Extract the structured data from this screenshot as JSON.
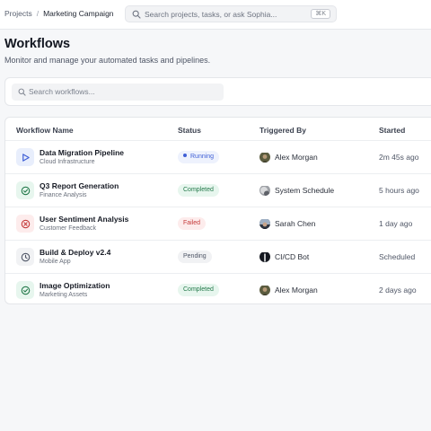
{
  "breadcrumb": {
    "parent": "Projects",
    "separator": "/",
    "current": "Marketing Campaign"
  },
  "global_search": {
    "placeholder": "Search projects, tasks, or ask Sophia...",
    "shortcut": "⌘K"
  },
  "page": {
    "title": "Workflows",
    "subtitle": "Monitor and manage your automated tasks and pipelines."
  },
  "filter": {
    "search_placeholder": "Search workflows..."
  },
  "table": {
    "columns": [
      "Workflow Name",
      "Status",
      "Triggered By",
      "Started"
    ],
    "rows": [
      {
        "name": "Data Migration Pipeline",
        "sub": "Cloud Infrastructure",
        "status": "Running",
        "trigger": "Alex Morgan",
        "started": "2m 45s ago",
        "icon": "play-icon"
      },
      {
        "name": "Q3 Report Generation",
        "sub": "Finance Analysis",
        "status": "Completed",
        "trigger": "System Schedule",
        "started": "5 hours ago",
        "icon": "check-circle-icon"
      },
      {
        "name": "User Sentiment Analysis",
        "sub": "Customer Feedback",
        "status": "Failed",
        "trigger": "Sarah Chen",
        "started": "1 day ago",
        "icon": "x-circle-icon"
      },
      {
        "name": "Build & Deploy v2.4",
        "sub": "Mobile App",
        "status": "Pending",
        "trigger": "CI/CD Bot",
        "started": "Scheduled",
        "icon": "clock-icon"
      },
      {
        "name": "Image Optimization",
        "sub": "Marketing Assets",
        "status": "Completed",
        "trigger": "Alex Morgan",
        "started": "2 days ago",
        "icon": "check-circle-icon"
      }
    ]
  },
  "colors": {
    "running_bg": "#eef2fd",
    "running_fg": "#3f5fd6",
    "completed_bg": "#e7f6ee",
    "completed_fg": "#23794a",
    "failed_bg": "#fdecec",
    "failed_fg": "#c53b3b",
    "pending_bg": "#f1f2f4",
    "pending_fg": "#4f5666"
  }
}
